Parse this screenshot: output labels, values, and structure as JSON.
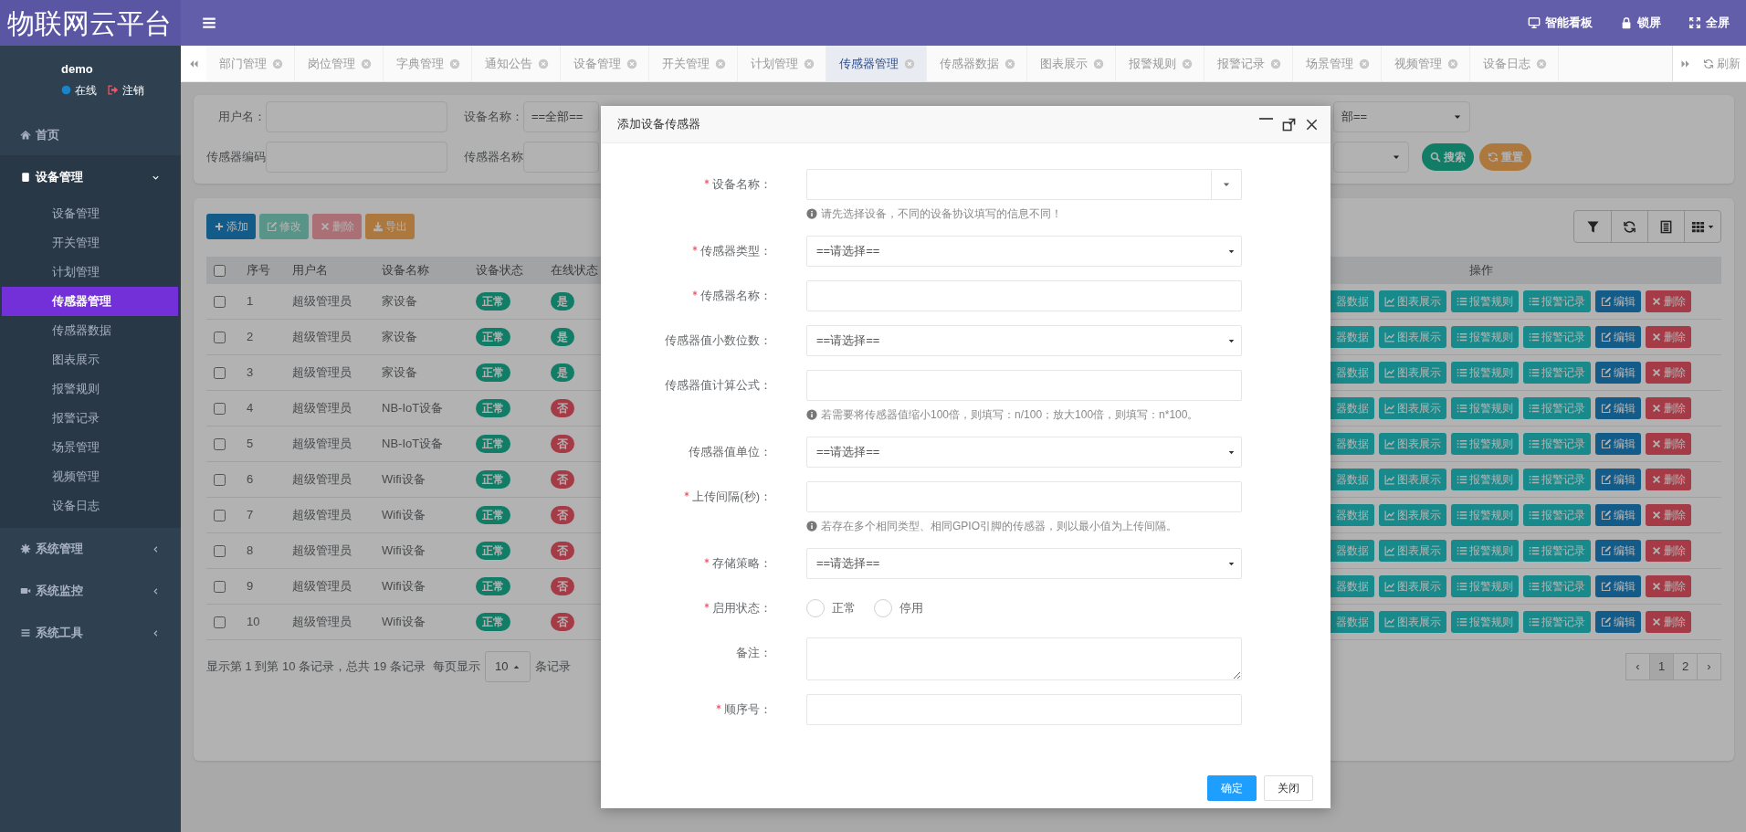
{
  "logo": "物联网云平台",
  "header": {
    "actions": [
      "智能看板",
      "锁屏",
      "全屏"
    ]
  },
  "user": {
    "name": "demo",
    "status": "在线",
    "logout": "注销"
  },
  "menu": [
    {
      "label": "首页",
      "kind": "link"
    },
    {
      "label": "设备管理",
      "kind": "group",
      "expanded": true,
      "children": [
        {
          "label": "设备管理",
          "selected": false
        },
        {
          "label": "开关管理",
          "selected": false
        },
        {
          "label": "计划管理",
          "selected": false
        },
        {
          "label": "传感器管理",
          "selected": true
        },
        {
          "label": "传感器数据",
          "selected": false
        },
        {
          "label": "图表展示",
          "selected": false
        },
        {
          "label": "报警规则",
          "selected": false
        },
        {
          "label": "报警记录",
          "selected": false
        },
        {
          "label": "场景管理",
          "selected": false
        },
        {
          "label": "视频管理",
          "selected": false
        },
        {
          "label": "设备日志",
          "selected": false
        }
      ]
    },
    {
      "label": "系统管理",
      "kind": "group",
      "expanded": false
    },
    {
      "label": "系统监控",
      "kind": "group",
      "expanded": false
    },
    {
      "label": "系统工具",
      "kind": "group",
      "expanded": false
    }
  ],
  "tabs": [
    {
      "label": "部门管理",
      "selected": false
    },
    {
      "label": "岗位管理",
      "selected": false
    },
    {
      "label": "字典管理",
      "selected": false
    },
    {
      "label": "通知公告",
      "selected": false
    },
    {
      "label": "设备管理",
      "selected": false
    },
    {
      "label": "开关管理",
      "selected": false
    },
    {
      "label": "计划管理",
      "selected": false
    },
    {
      "label": "传感器管理",
      "selected": true
    },
    {
      "label": "传感器数据",
      "selected": false
    },
    {
      "label": "图表展示",
      "selected": false
    },
    {
      "label": "报警规则",
      "selected": false
    },
    {
      "label": "报警记录",
      "selected": false
    },
    {
      "label": "场景管理",
      "selected": false
    },
    {
      "label": "视频管理",
      "selected": false
    },
    {
      "label": "设备日志",
      "selected": false
    }
  ],
  "tab_refresh": "刷新",
  "search": {
    "rows": [
      [
        {
          "label": "用户名：",
          "kind": "input"
        },
        {
          "label": "设备名称：",
          "kind": "select",
          "value": "==全部=="
        },
        {
          "kind": "select",
          "value": "部=="
        }
      ],
      [
        {
          "label": "传感器编码",
          "kind": "input"
        },
        {
          "label": "传感器名称",
          "kind": "input"
        },
        {
          "kind": "select"
        }
      ]
    ],
    "buttons": [
      {
        "label": "搜索",
        "kind": "search"
      },
      {
        "label": "重置",
        "kind": "reset"
      }
    ]
  },
  "toolbar": [
    {
      "label": "添加",
      "kind": "add",
      "disabled": false
    },
    {
      "label": "修改",
      "kind": "edit",
      "disabled": true
    },
    {
      "label": "删除",
      "kind": "delete",
      "disabled": true
    },
    {
      "label": "导出",
      "kind": "export",
      "disabled": false
    }
  ],
  "table": {
    "select_all": false,
    "columns": [
      "序号",
      "用户名",
      "设备名称",
      "设备状态",
      "在线状态",
      "操作"
    ],
    "rows": [
      {
        "selected": false,
        "number": "1",
        "user": "超级管理员",
        "device": "家设备",
        "status": "正常",
        "online": "是",
        "online_ok": true,
        "actions": [
          {
            "label": "器数据",
            "kind": "data"
          },
          {
            "label": "图表展示",
            "kind": "chart"
          },
          {
            "label": "报警规则",
            "kind": "rules"
          },
          {
            "label": "报警记录",
            "kind": "records"
          },
          {
            "label": "编辑",
            "kind": "edit"
          },
          {
            "label": "删除",
            "kind": "delete"
          }
        ]
      },
      {
        "selected": false,
        "number": "2",
        "user": "超级管理员",
        "device": "家设备",
        "status": "正常",
        "online": "是",
        "online_ok": true,
        "actions": [
          {
            "label": "器数据",
            "kind": "data"
          },
          {
            "label": "图表展示",
            "kind": "chart"
          },
          {
            "label": "报警规则",
            "kind": "rules"
          },
          {
            "label": "报警记录",
            "kind": "records"
          },
          {
            "label": "编辑",
            "kind": "edit"
          },
          {
            "label": "删除",
            "kind": "delete"
          }
        ]
      },
      {
        "selected": false,
        "number": "3",
        "user": "超级管理员",
        "device": "家设备",
        "status": "正常",
        "online": "是",
        "online_ok": true,
        "actions": [
          {
            "label": "器数据",
            "kind": "data"
          },
          {
            "label": "图表展示",
            "kind": "chart"
          },
          {
            "label": "报警规则",
            "kind": "rules"
          },
          {
            "label": "报警记录",
            "kind": "records"
          },
          {
            "label": "编辑",
            "kind": "edit"
          },
          {
            "label": "删除",
            "kind": "delete"
          }
        ]
      },
      {
        "selected": false,
        "number": "4",
        "user": "超级管理员",
        "device": "NB-IoT设备",
        "status": "正常",
        "online": "否",
        "online_ok": false,
        "actions": [
          {
            "label": "器数据",
            "kind": "data"
          },
          {
            "label": "图表展示",
            "kind": "chart"
          },
          {
            "label": "报警规则",
            "kind": "rules"
          },
          {
            "label": "报警记录",
            "kind": "records"
          },
          {
            "label": "编辑",
            "kind": "edit"
          },
          {
            "label": "删除",
            "kind": "delete"
          }
        ]
      },
      {
        "selected": false,
        "number": "5",
        "user": "超级管理员",
        "device": "NB-IoT设备",
        "status": "正常",
        "online": "否",
        "online_ok": false,
        "actions": [
          {
            "label": "器数据",
            "kind": "data"
          },
          {
            "label": "图表展示",
            "kind": "chart"
          },
          {
            "label": "报警规则",
            "kind": "rules"
          },
          {
            "label": "报警记录",
            "kind": "records"
          },
          {
            "label": "编辑",
            "kind": "edit"
          },
          {
            "label": "删除",
            "kind": "delete"
          }
        ]
      },
      {
        "selected": false,
        "number": "6",
        "user": "超级管理员",
        "device": "Wifi设备",
        "status": "正常",
        "online": "否",
        "online_ok": false,
        "actions": [
          {
            "label": "器数据",
            "kind": "data"
          },
          {
            "label": "图表展示",
            "kind": "chart"
          },
          {
            "label": "报警规则",
            "kind": "rules"
          },
          {
            "label": "报警记录",
            "kind": "records"
          },
          {
            "label": "编辑",
            "kind": "edit"
          },
          {
            "label": "删除",
            "kind": "delete"
          }
        ]
      },
      {
        "selected": false,
        "number": "7",
        "user": "超级管理员",
        "device": "Wifi设备",
        "status": "正常",
        "online": "否",
        "online_ok": false,
        "actions": [
          {
            "label": "器数据",
            "kind": "data"
          },
          {
            "label": "图表展示",
            "kind": "chart"
          },
          {
            "label": "报警规则",
            "kind": "rules"
          },
          {
            "label": "报警记录",
            "kind": "records"
          },
          {
            "label": "编辑",
            "kind": "edit"
          },
          {
            "label": "删除",
            "kind": "delete"
          }
        ]
      },
      {
        "selected": false,
        "number": "8",
        "user": "超级管理员",
        "device": "Wifi设备",
        "status": "正常",
        "online": "否",
        "online_ok": false,
        "actions": [
          {
            "label": "器数据",
            "kind": "data"
          },
          {
            "label": "图表展示",
            "kind": "chart"
          },
          {
            "label": "报警规则",
            "kind": "rules"
          },
          {
            "label": "报警记录",
            "kind": "records"
          },
          {
            "label": "编辑",
            "kind": "edit"
          },
          {
            "label": "删除",
            "kind": "delete"
          }
        ]
      },
      {
        "selected": false,
        "number": "9",
        "user": "超级管理员",
        "device": "Wifi设备",
        "status": "正常",
        "online": "否",
        "online_ok": false,
        "actions": [
          {
            "label": "器数据",
            "kind": "data"
          },
          {
            "label": "图表展示",
            "kind": "chart"
          },
          {
            "label": "报警规则",
            "kind": "rules"
          },
          {
            "label": "报警记录",
            "kind": "records"
          },
          {
            "label": "编辑",
            "kind": "edit"
          },
          {
            "label": "删除",
            "kind": "delete"
          }
        ]
      },
      {
        "selected": false,
        "number": "10",
        "user": "超级管理员",
        "device": "Wifi设备",
        "status": "正常",
        "online": "否",
        "online_ok": false,
        "actions": [
          {
            "label": "器数据",
            "kind": "data"
          },
          {
            "label": "图表展示",
            "kind": "chart"
          },
          {
            "label": "报警规则",
            "kind": "rules"
          },
          {
            "label": "报警记录",
            "kind": "records"
          },
          {
            "label": "编辑",
            "kind": "edit"
          },
          {
            "label": "删除",
            "kind": "delete"
          }
        ]
      }
    ]
  },
  "footer": {
    "summary": "显示第 1 到第 10 条记录，总共 19 条记录",
    "per_page_label": "每页显示",
    "page_size": "10",
    "per_page_suffix": "条记录"
  },
  "pagination": [
    {
      "label": "‹",
      "selected": false
    },
    {
      "label": "1",
      "selected": true
    },
    {
      "label": "2",
      "selected": false
    },
    {
      "label": "›",
      "selected": false
    }
  ],
  "modal": {
    "title": "添加设备传感器",
    "fields": [
      {
        "label": "设备名称：",
        "required": true,
        "kind": "combo",
        "hint": "请先选择设备，不同的设备协议填写的信息不同！"
      },
      {
        "label": "传感器类型：",
        "required": true,
        "kind": "select",
        "value": "==请选择=="
      },
      {
        "label": "传感器名称：",
        "required": true,
        "kind": "input"
      },
      {
        "label": "传感器值小数位数：",
        "required": false,
        "kind": "select",
        "value": "==请选择=="
      },
      {
        "label": "传感器值计算公式：",
        "required": false,
        "kind": "input",
        "hint": "若需要将传感器值缩小100倍，则填写：n/100；放大100倍，则填写：n*100。"
      },
      {
        "label": "传感器值单位：",
        "required": false,
        "kind": "select",
        "value": "==请选择=="
      },
      {
        "label": "上传间隔(秒)：",
        "required": true,
        "kind": "input",
        "hint": "若存在多个相同类型、相同GPIO引脚的传感器，则以最小值为上传间隔。"
      },
      {
        "label": "存储策略：",
        "required": true,
        "kind": "select",
        "value": "==请选择=="
      },
      {
        "label": "启用状态：",
        "required": true,
        "kind": "radio",
        "options": [
          {
            "label": "正常",
            "checked": false
          },
          {
            "label": "停用",
            "checked": false
          }
        ]
      },
      {
        "label": "备注：",
        "required": false,
        "kind": "textarea"
      },
      {
        "label": "顺序号：",
        "required": true,
        "kind": "input"
      }
    ],
    "buttons": [
      {
        "label": "确定",
        "kind": "primary"
      },
      {
        "label": "关闭",
        "kind": "default"
      }
    ]
  }
}
